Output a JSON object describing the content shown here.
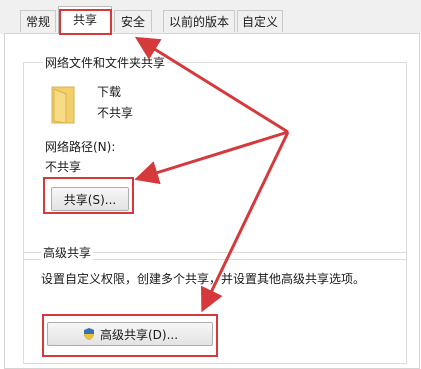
{
  "tabs": [
    {
      "label": "常规"
    },
    {
      "label": "共享"
    },
    {
      "label": "安全"
    },
    {
      "label": "以前的版本"
    },
    {
      "label": "自定义"
    }
  ],
  "active_tab": "共享",
  "network_share": {
    "group_title": "网络文件和文件夹共享",
    "folder_name": "下载",
    "folder_status": "不共享",
    "path_label": "网络路径(N):",
    "path_value": "不共享",
    "share_button": "共享(S)..."
  },
  "advanced_share": {
    "group_title": "高级共享",
    "description": "设置自定义权限，创建多个共享，并设置其他高级共享选项。",
    "button_label": "高级共享(D)...",
    "button_icon": "shield-icon"
  },
  "colors": {
    "highlight": "#d6393b",
    "folder": "#f2cf6b"
  }
}
